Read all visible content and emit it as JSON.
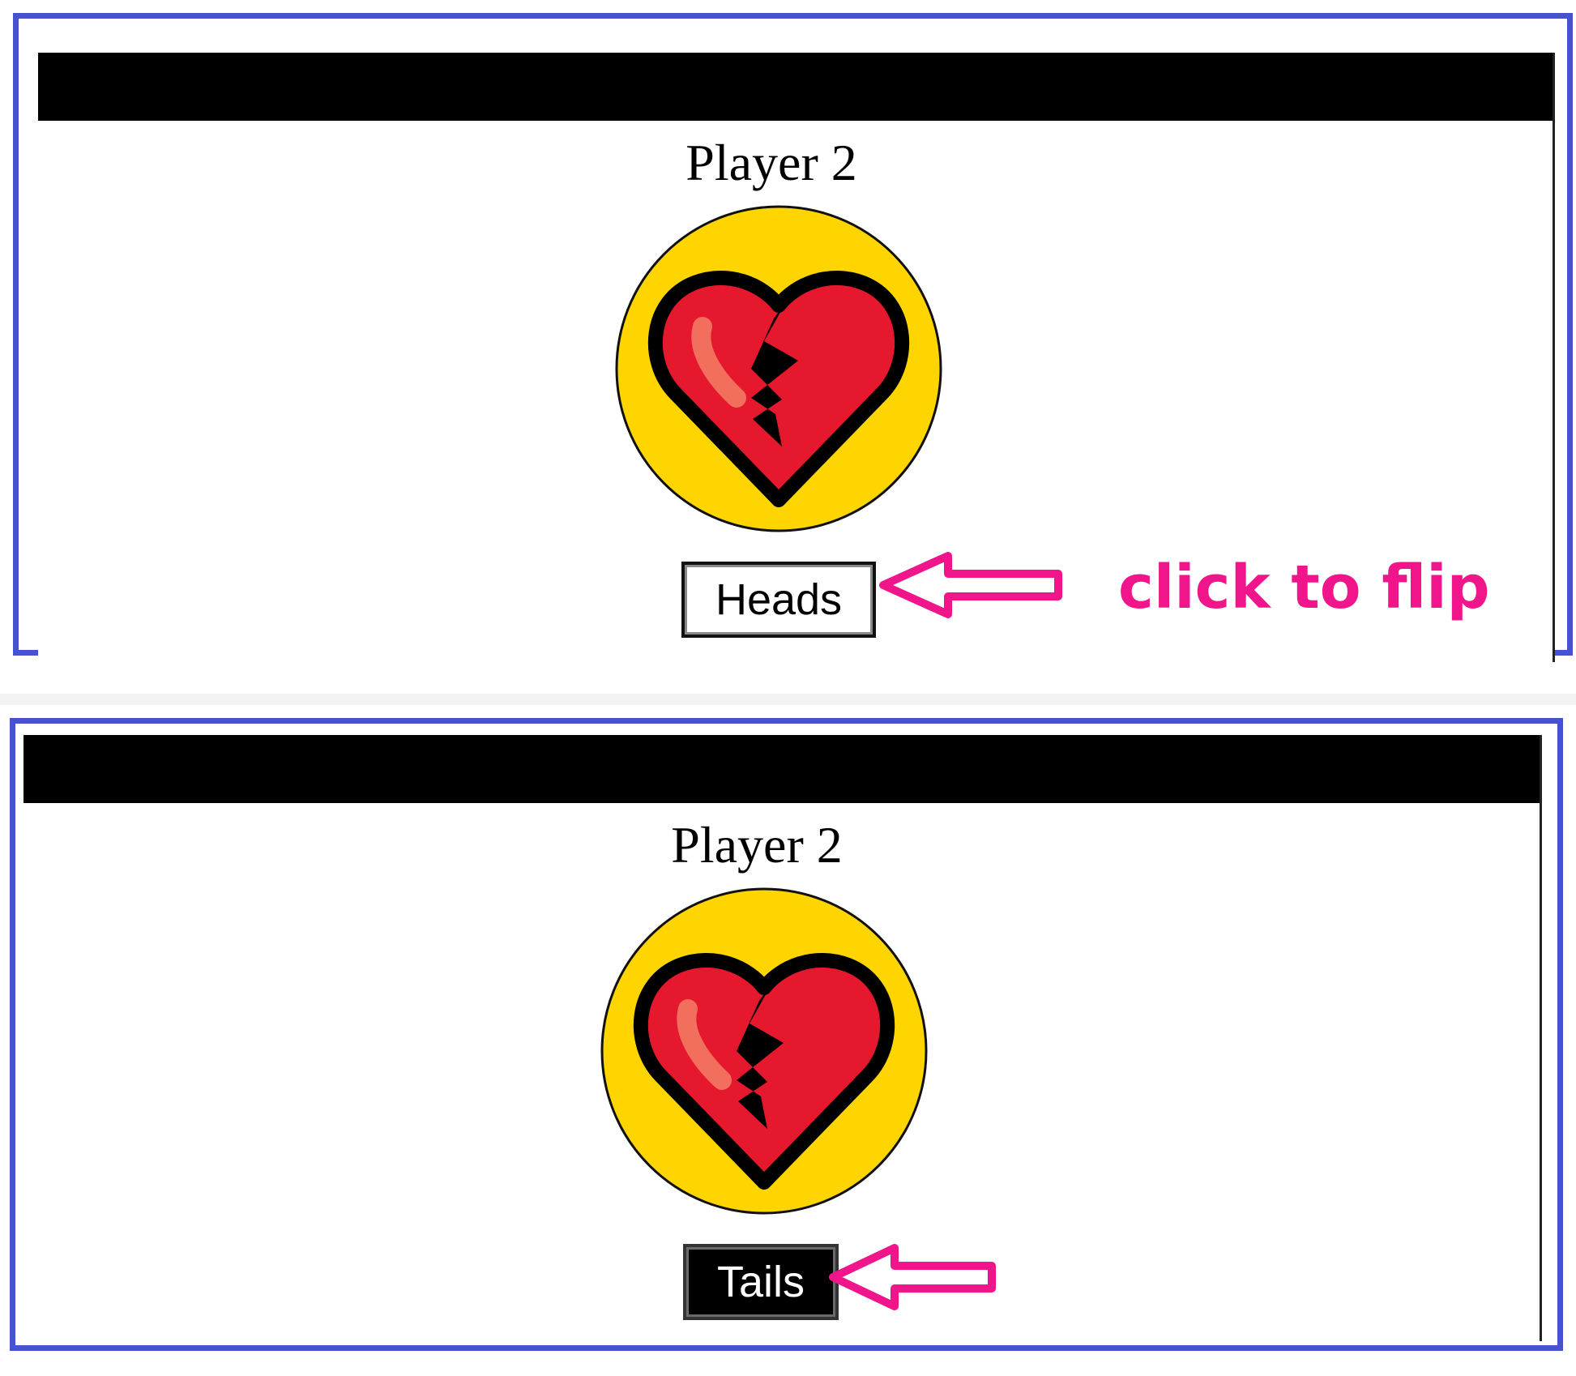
{
  "panels": [
    {
      "player_label": "Player 2",
      "button_label": "Heads",
      "button_state": "outlined",
      "coin_icon": "broken-heart-icon"
    },
    {
      "player_label": "Player 2",
      "button_label": "Tails",
      "button_state": "filled",
      "coin_icon": "broken-heart-icon"
    }
  ],
  "annotation": {
    "hint": "click to flip",
    "arrow_icon": "left-arrow-icon"
  },
  "colors": {
    "panel_border": "#4652cf",
    "coin_fill": "#ffd500",
    "heart_fill": "#e5182d",
    "heart_highlight": "#f26f5e",
    "annotation": "#f0158a"
  }
}
